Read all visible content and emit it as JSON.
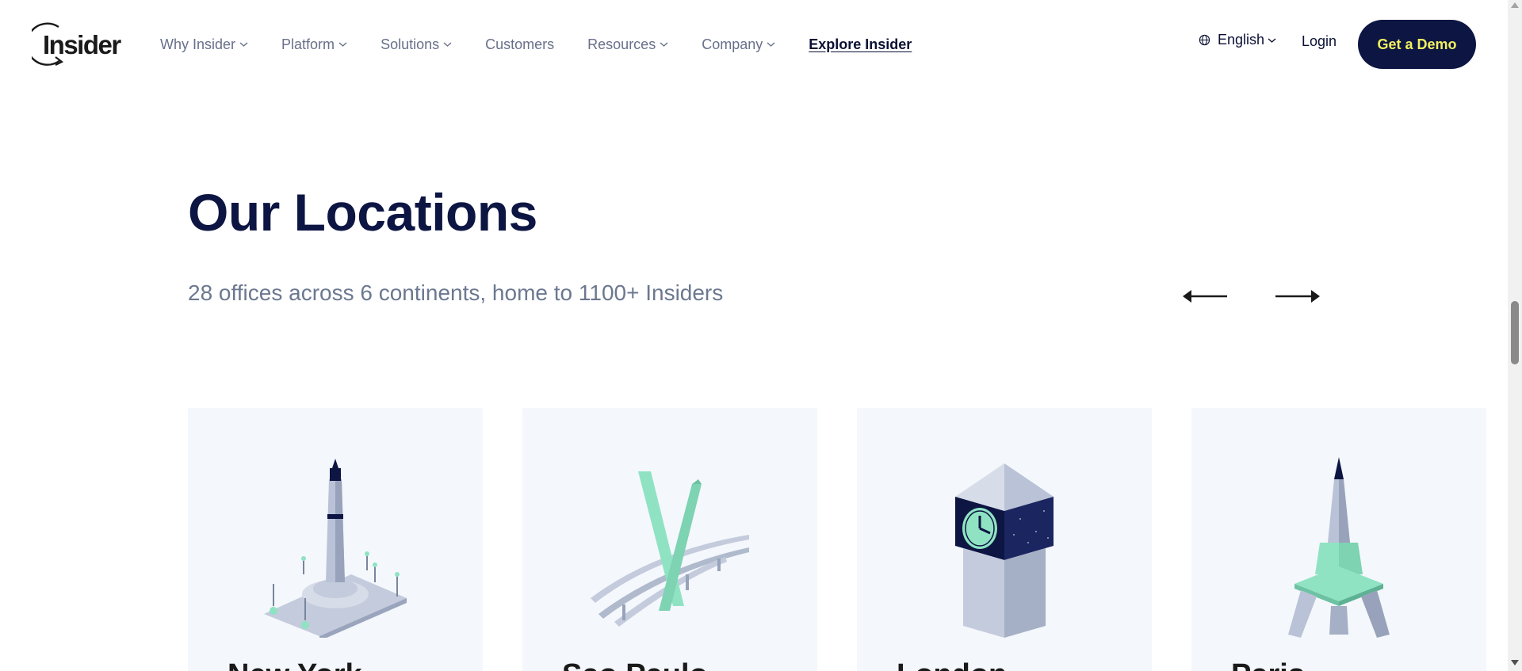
{
  "header": {
    "logo_text": "Insider",
    "nav": [
      {
        "label": "Why Insider",
        "dropdown": true
      },
      {
        "label": "Platform",
        "dropdown": true
      },
      {
        "label": "Solutions",
        "dropdown": true
      },
      {
        "label": "Customers",
        "dropdown": false
      },
      {
        "label": "Resources",
        "dropdown": true
      },
      {
        "label": "Company",
        "dropdown": true
      },
      {
        "label": "Explore Insider",
        "dropdown": false
      }
    ],
    "language": "English",
    "login": "Login",
    "cta": "Get a Demo"
  },
  "section": {
    "title": "Our Locations",
    "subtitle": "28 offices across 6 continents, home to 1100+ Insiders"
  },
  "locations": [
    {
      "city": "New York",
      "icon": "monument-icon"
    },
    {
      "city": "Sao Paulo",
      "icon": "bridge-icon"
    },
    {
      "city": "London",
      "icon": "clock-tower-icon"
    },
    {
      "city": "Paris",
      "icon": "eiffel-tower-icon"
    }
  ],
  "colors": {
    "brand_navy": "#0d1543",
    "cta_text": "#f2f05f",
    "accent_mint": "#8fe3c3",
    "card_bg": "#f4f7fb"
  }
}
